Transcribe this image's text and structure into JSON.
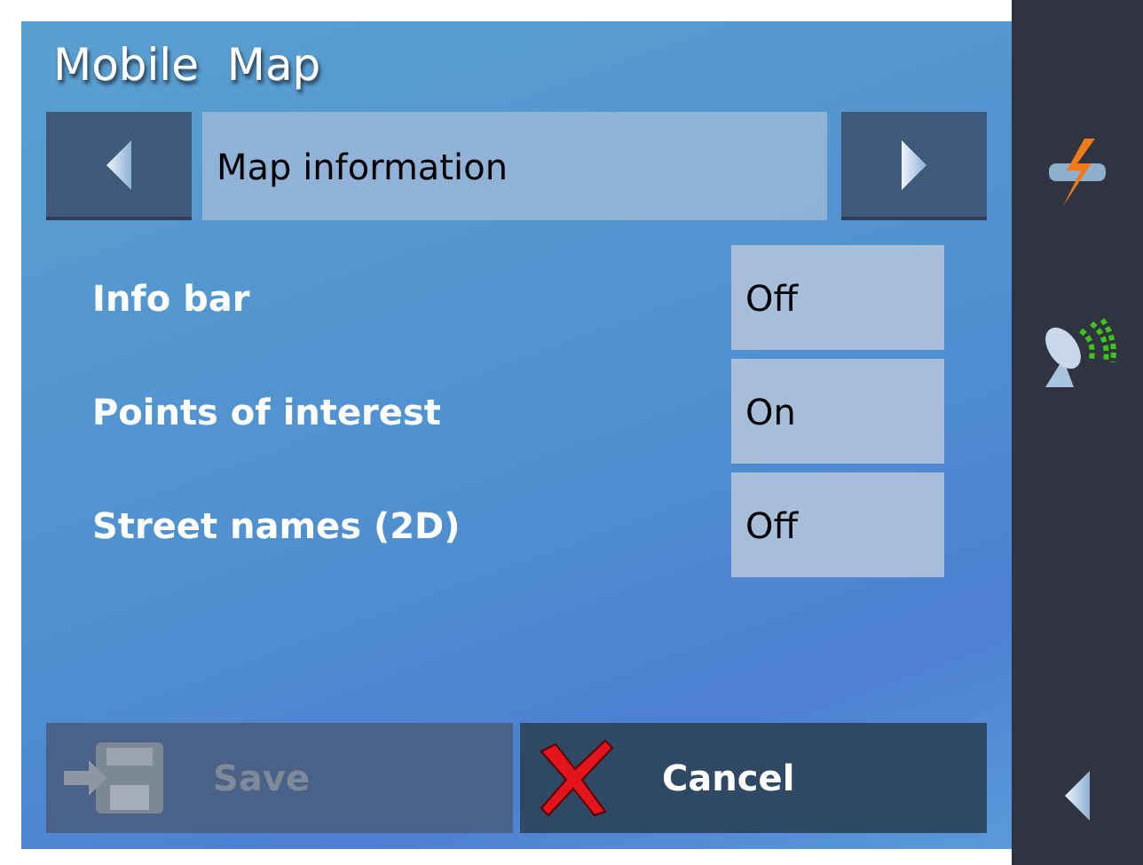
{
  "window": {
    "title": "Mobile  Map"
  },
  "category": {
    "label": "Map information"
  },
  "settings": [
    {
      "label": "Info bar",
      "value": "Off"
    },
    {
      "label": "Points of interest",
      "value": "On"
    },
    {
      "label": "Street names (2D)",
      "value": "Off"
    }
  ],
  "buttons": [
    {
      "label": "Save",
      "kind": "save",
      "disabled": true
    },
    {
      "label": "Cancel",
      "kind": "cancel",
      "disabled": false
    }
  ]
}
